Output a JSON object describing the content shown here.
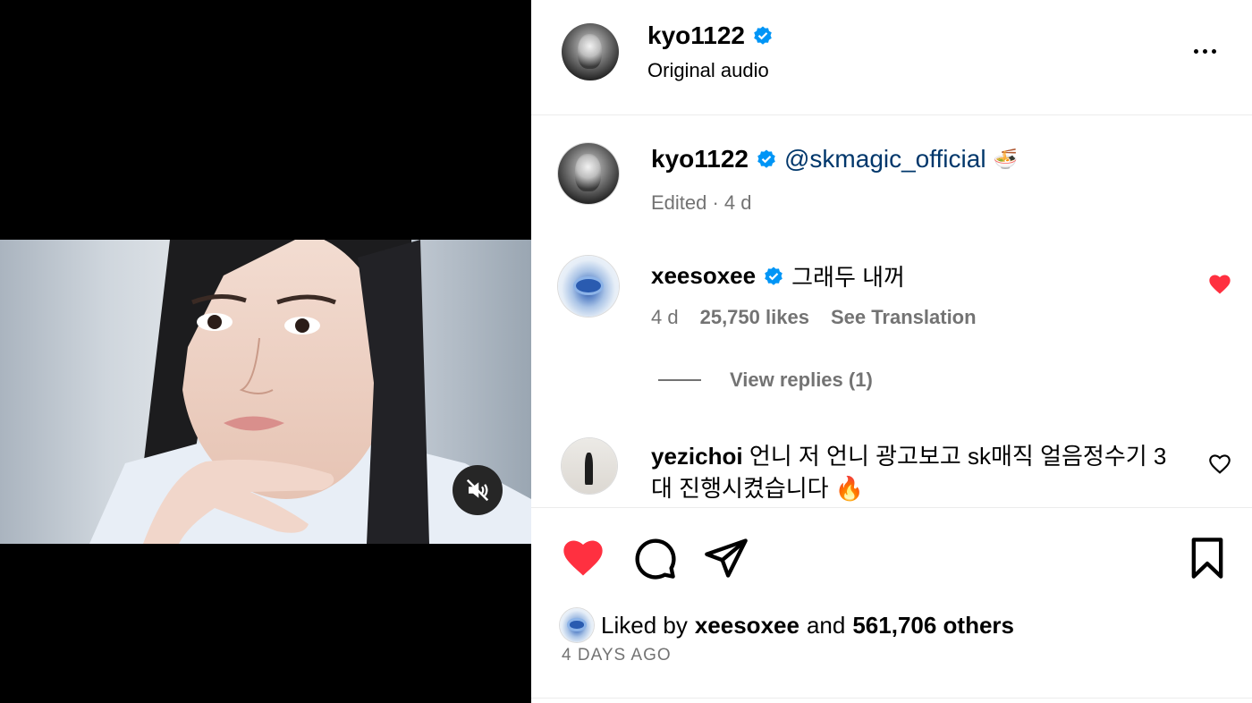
{
  "post": {
    "author": "kyo1122",
    "audio": "Original audio"
  },
  "caption": {
    "author": "kyo1122",
    "mention": "@skmagic_official",
    "emoji": "🍜",
    "meta": "Edited · 4 d"
  },
  "comments": [
    {
      "author": "xeesoxee",
      "text": "그래두 내꺼",
      "age": "4 d",
      "likes": "25,750 likes",
      "translate": "See Translation",
      "replies": "View replies (1)",
      "liked": true
    },
    {
      "author": "yezichoi",
      "text": "언니 저 언니 광고보고 sk매직 얼음정수기 3대 진행시켰습니다",
      "emoji": "🔥",
      "liked": false
    }
  ],
  "likes": {
    "prefix": "Liked by",
    "user": "xeesoxee",
    "joiner": "and",
    "others": "561,706 others"
  },
  "date": "4 DAYS AGO",
  "icons": {
    "mute": "speaker-muted-icon",
    "more": "more-dots-icon",
    "verified": "verified-badge-icon",
    "like": "heart-icon",
    "comment": "comment-bubble-icon",
    "share": "paper-plane-icon",
    "save": "bookmark-icon"
  },
  "colors": {
    "heart": "#ff3040",
    "verified": "#0095f6",
    "mention": "#00376b",
    "muted_text": "#737373"
  }
}
